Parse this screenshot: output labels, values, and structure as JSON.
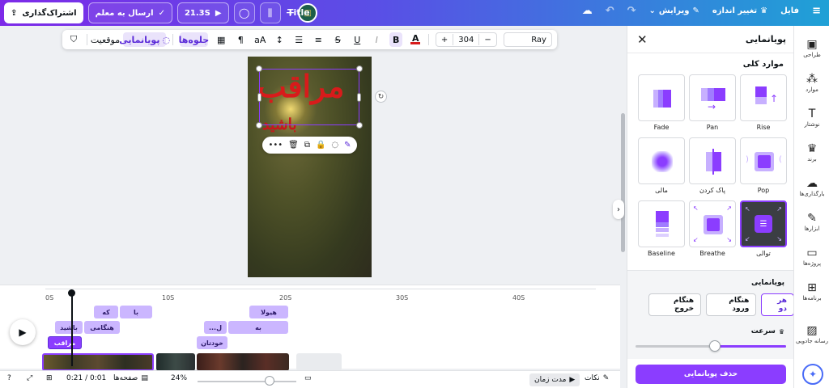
{
  "topbar": {
    "share_label": "اشتراک‌گذاری",
    "send_label": "ارسال به معلم",
    "duration_label": "21.3S",
    "title": "Title",
    "resize_label": "تغییر اندازه",
    "edit_label": "ویرایش",
    "file_label": "فایل"
  },
  "text_toolbar": {
    "font_value": "Ray",
    "font_size": "304",
    "minus": "−",
    "plus": "+",
    "bold": "B",
    "italic": "I",
    "underline": "U",
    "strike": "S",
    "case": "aA",
    "effects_label": "جلوه‌ها",
    "animate_label": "پویانمایی",
    "position_label": "موقعیت"
  },
  "canvas": {
    "big_text": "مراقب",
    "small_text": "باشید"
  },
  "panel": {
    "title": "پویانمایی",
    "section_label": "موارد کلی",
    "animations": [
      {
        "label": "Rise",
        "selected": false
      },
      {
        "label": "Pan",
        "selected": false
      },
      {
        "label": "Fade",
        "selected": false
      },
      {
        "label": "Pop",
        "selected": false
      },
      {
        "label": "پاک کردن",
        "selected": false
      },
      {
        "label": "مالی",
        "selected": false
      },
      {
        "label": "توالی",
        "selected": true
      },
      {
        "label": "Breathe",
        "selected": false
      },
      {
        "label": "Baseline",
        "selected": false
      }
    ],
    "bottom_label": "پویانمایی",
    "modes": [
      "هر دو",
      "هنگام ورود",
      "هنگام خروج"
    ],
    "speed_label": "سرعت",
    "speed_level": 0.53,
    "remove_label": "حذف پویانمایی"
  },
  "rail": {
    "items": [
      {
        "label": "طراحی",
        "icon": "layout-icon"
      },
      {
        "label": "موارد",
        "icon": "elements-icon"
      },
      {
        "label": "نوشتار",
        "icon": "text-icon"
      },
      {
        "label": "برند",
        "icon": "brand-icon"
      },
      {
        "label": "بارگذاری‌ها",
        "icon": "upload-icon"
      },
      {
        "label": "ابزارها",
        "icon": "draw-icon"
      },
      {
        "label": "پروژه‌ها",
        "icon": "folder-icon"
      },
      {
        "label": "برنامه‌ها",
        "icon": "apps-icon"
      },
      {
        "label": "رسانه جادویی",
        "icon": "magic-media-icon"
      }
    ]
  },
  "timeline": {
    "ticks": [
      "0S",
      "10S",
      "20S",
      "30S",
      "40S"
    ],
    "clips": {
      "row1_a": "با",
      "row1_b": "که",
      "row1_c": "هیولا",
      "row2_a": "باشید",
      "row2_b": "هنگامی",
      "row2_c": "...ل",
      "row2_d": "به",
      "row3_a": "مراقب",
      "row3_b": "خودتان"
    }
  },
  "statusbar": {
    "time": "0:21 / 0:01",
    "pages_label": "صفحه‌ها",
    "zoom": "24%",
    "duration_label": "مدت زمان",
    "notes_label": "نکات"
  },
  "colors": {
    "accent": "#8b3dff",
    "text_red": "#d81b1b"
  }
}
